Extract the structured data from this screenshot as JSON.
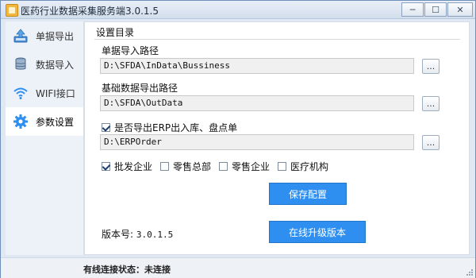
{
  "window": {
    "title": "医药行业数据采集服务端3.0.1.5",
    "minimize_glyph": "─",
    "maximize_glyph": "☐",
    "close_glyph": "✕"
  },
  "sidebar": {
    "items": [
      {
        "label": "单据导出",
        "icon": "document-upload-icon",
        "active": false
      },
      {
        "label": "数据导入",
        "icon": "database-icon",
        "active": false
      },
      {
        "label": "WIFI接口",
        "icon": "wifi-icon",
        "active": false
      },
      {
        "label": "参数设置",
        "icon": "gear-icon",
        "active": true
      }
    ]
  },
  "settings": {
    "section_title": "设置目录",
    "doc_import": {
      "label": "单据导入路径",
      "value": "D:\\SFDA\\InData\\Bussiness",
      "browse_label": "..."
    },
    "base_export": {
      "label": "基础数据导出路径",
      "value": "D:\\SFDA\\OutData",
      "browse_label": "..."
    },
    "erp_export": {
      "checkbox_label": "是否导出ERP出入库、盘点单",
      "checked": true,
      "value": "D:\\ERPOrder",
      "browse_label": "..."
    },
    "enterprise_types": [
      {
        "label": "批发企业",
        "checked": true
      },
      {
        "label": "零售总部",
        "checked": false
      },
      {
        "label": "零售企业",
        "checked": false
      },
      {
        "label": "医疗机构",
        "checked": false
      }
    ],
    "save_button": "保存配置",
    "version_label": "版本号:",
    "version_value": "3.0.1.5",
    "upgrade_button": "在线升级版本"
  },
  "status": {
    "text": "有线连接状态：未连接"
  },
  "colors": {
    "accent": "#2f8ff0",
    "sidebar_bg": "#edf2f8",
    "window_border": "#6d8fb8"
  }
}
